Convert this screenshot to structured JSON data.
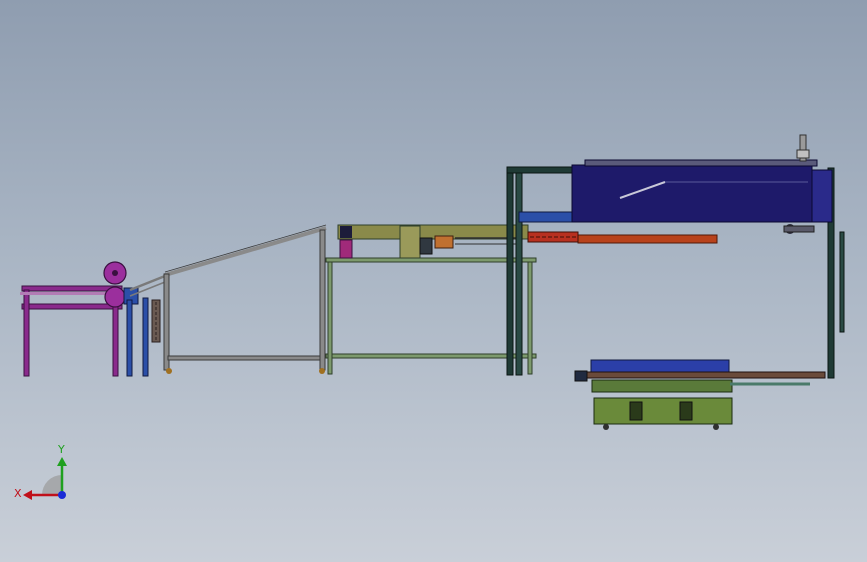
{
  "viewport": {
    "background_top": "#8f9db0",
    "background_bottom": "#c9cfd8"
  },
  "triad": {
    "x_label": "X",
    "y_label": "Y",
    "x_color": "#c0101a",
    "y_color": "#1fa01f",
    "z_color": "#1a2bd6"
  },
  "colors": {
    "purple_frame": "#8a2a8c",
    "grey_frame": "#8a8a8a",
    "green_frame": "#6f8a5f",
    "dark_green_frame": "#1f3a35",
    "navy_hood": "#1e1a6a",
    "orange_bar": "#b8421c",
    "blue_part": "#2b4fa8"
  }
}
